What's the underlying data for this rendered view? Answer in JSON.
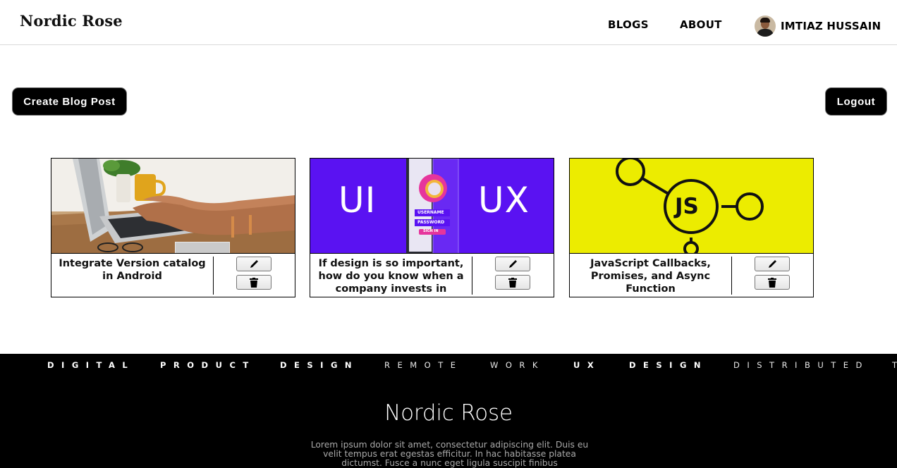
{
  "header": {
    "brand": "Nordic Rose",
    "nav": [
      {
        "label": "BLOGS"
      },
      {
        "label": "ABOUT"
      }
    ],
    "user_name": "IMTIAZ HUSSAIN"
  },
  "actions": {
    "create_label": "Create Blog Post",
    "logout_label": "Logout"
  },
  "cards": [
    {
      "title": "Integrate Version catalog in Android",
      "image": "laptop-typing-photo"
    },
    {
      "title": "If design is so important, how do you know when a company invests in",
      "image": "ui-ux-banner",
      "image_text": {
        "left": "UI",
        "right": "UX",
        "username": "USERNAME",
        "password": "PASSWORD",
        "button": "SIGN IN"
      }
    },
    {
      "title": "JavaScript Callbacks, Promises, and Async Function",
      "image": "js-network-graphic",
      "image_text": {
        "center": "JS"
      }
    }
  ],
  "footer": {
    "ticker": [
      "DIGITAL",
      "PRODUCT",
      "DESIGN",
      "REMOTE",
      "WORK",
      "UX",
      "DESIGN",
      "DISTRIBUTED",
      "T"
    ],
    "brand": "Nordic Rose",
    "text": "Lorem ipsum dolor sit amet, consectetur adipiscing elit. Duis eu velit tempus erat egestas efficitur. In hac habitasse platea dictumst. Fusce a nunc eget ligula suscipit finibus"
  },
  "colors": {
    "ui_ux_purple": "#5a12f2",
    "js_yellow": "#ecec00",
    "button_dark": "#000000"
  },
  "icons": {
    "edit": "pencil-icon",
    "delete": "trash-icon"
  }
}
